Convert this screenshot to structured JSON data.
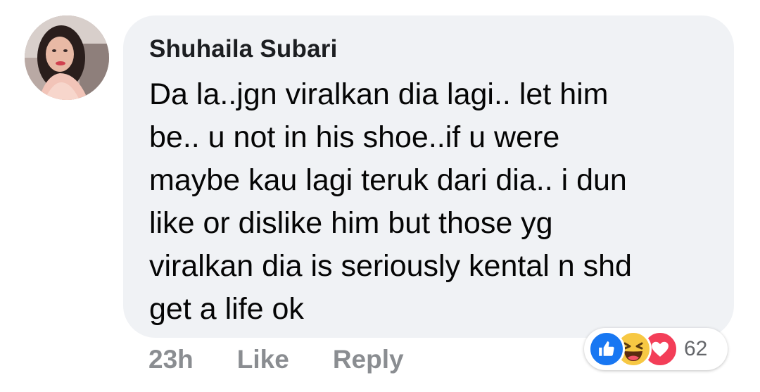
{
  "comment": {
    "author": "Shuhaila Subari",
    "text": "Da la..jgn viralkan dia lagi.. let him\nbe.. u not in his shoe..if u were\nmaybe kau lagi teruk dari dia..  i dun\nlike or dislike him but those yg\nviralkan dia is seriously kental n shd\nget a life ok",
    "time": "23h",
    "like_label": "Like",
    "reply_label": "Reply",
    "reactions": {
      "icons": [
        "like-icon",
        "haha-icon",
        "love-icon"
      ],
      "count": "62"
    }
  },
  "colors": {
    "bubble": "#f0f2f5",
    "action_text": "#8a8d91",
    "like_blue": "#1877f2",
    "haha_yellow": "#f7c843",
    "love_red": "#f33e58"
  }
}
